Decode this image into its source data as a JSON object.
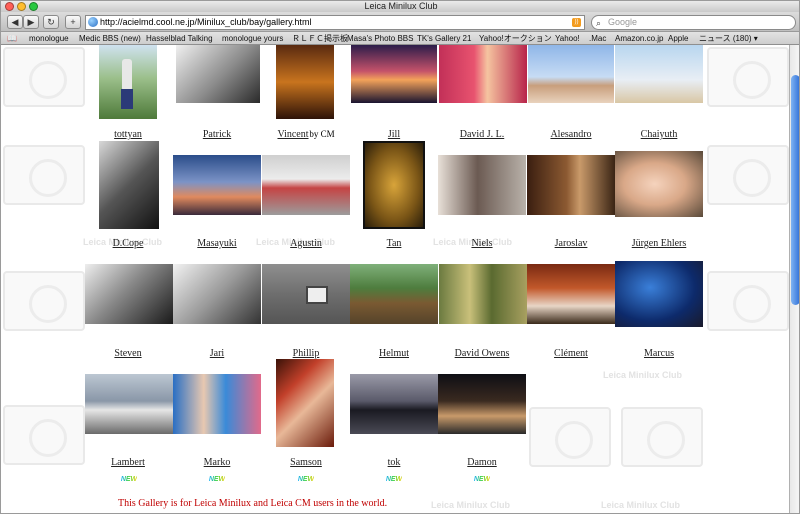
{
  "window": {
    "title": "Leica Minilux Club"
  },
  "toolbar": {
    "back_icon": "back-arrow-icon",
    "forward_icon": "forward-arrow-icon",
    "reload_icon": "reload-icon",
    "add_icon": "plus-icon",
    "url": "http://acielmd.cool.ne.jp/Minilux_club/bay/gallery.html",
    "search_placeholder": "Google"
  },
  "bookmarks": [
    {
      "label": "monologue"
    },
    {
      "label": "Medic BBS (new)"
    },
    {
      "label": "Hasselblad Talking"
    },
    {
      "label": "monologue yours"
    },
    {
      "label": "ＲＬＦＣ掲示板"
    },
    {
      "label": "Masa's Photo BBS"
    },
    {
      "label": "TK's Gallery 21"
    },
    {
      "label": "Yahoo!オークション"
    },
    {
      "label": "Yahoo!"
    },
    {
      "label": ".Mac"
    },
    {
      "label": "Amazon.co.jp"
    },
    {
      "label": "Apple"
    },
    {
      "label": "ニュース (180) ▾"
    }
  ],
  "gallery": {
    "watermark_text": "Leica Minilux Club",
    "row1": [
      "tottyan",
      "Patrick",
      "Vincent",
      "Jill",
      "David J. L.",
      "Alesandro",
      "Chaiyuth"
    ],
    "row1_note": "by CM",
    "row2": [
      "D.Cope",
      "Masayuki",
      "Agustin",
      "Tan",
      "Niels",
      "Jaroslav",
      "Jürgen Ehlers"
    ],
    "row3": [
      "Steven",
      "Jari",
      "Phillip",
      "Helmut",
      "David Owens",
      "Clément",
      "Marcus"
    ],
    "row4": [
      "Lambert",
      "Marko",
      "Samson",
      "tok",
      "Damon"
    ],
    "new_badge": "NEW"
  },
  "footer_text": "This Gallery is for Leica Minilux and Leica CM users in the world."
}
